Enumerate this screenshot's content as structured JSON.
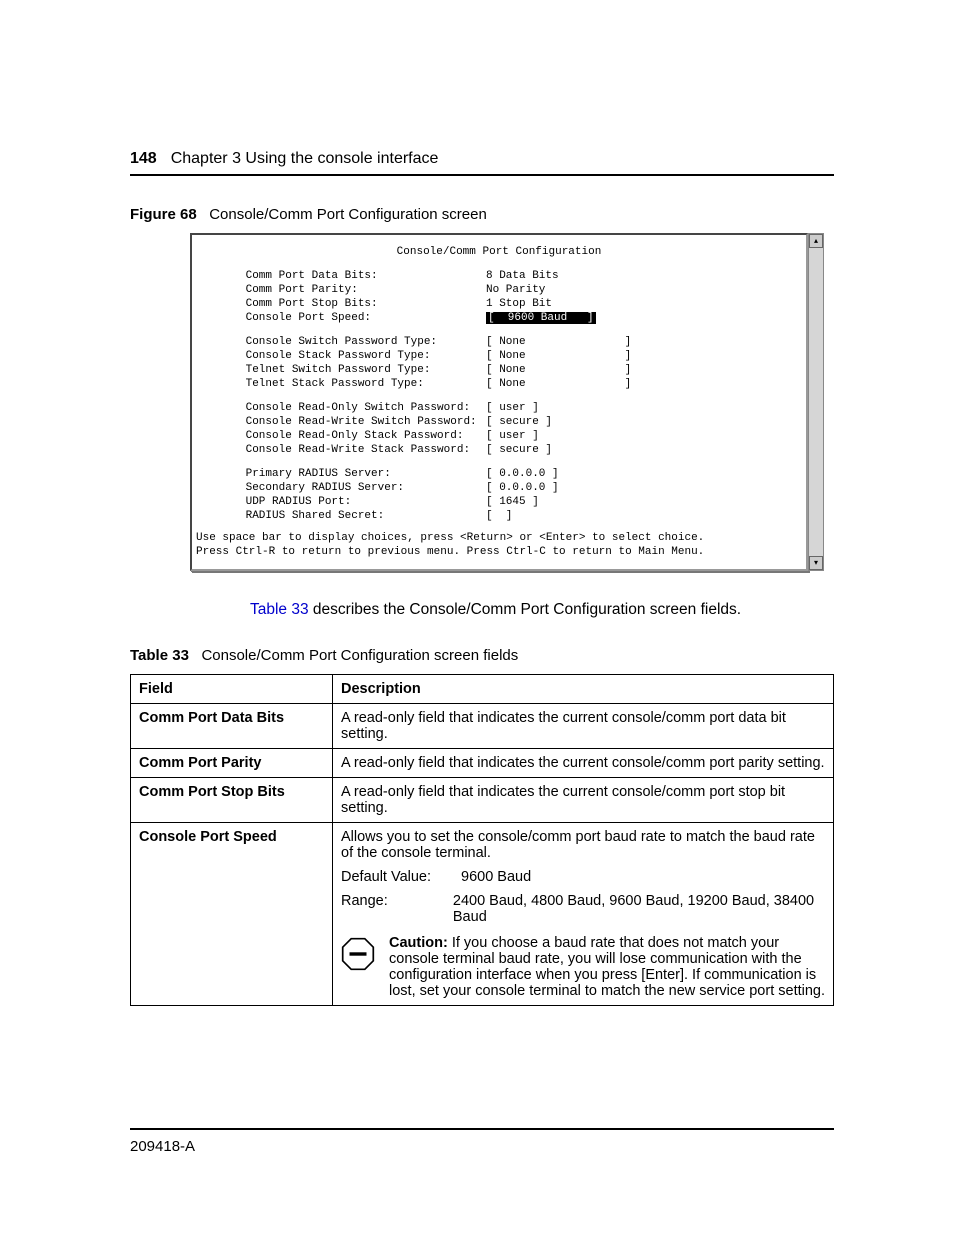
{
  "header": {
    "page_num": "148",
    "chapter": "Chapter 3  Using the console interface"
  },
  "figure": {
    "label": "Figure 68",
    "title": "Console/Comm Port Configuration screen"
  },
  "screenshot": {
    "title": "Console/Comm Port Configuration",
    "rows": [
      {
        "label": "Comm Port Data Bits:",
        "value": "8 Data Bits"
      },
      {
        "label": "Comm Port Parity:",
        "value": "No Parity"
      },
      {
        "label": "Comm Port Stop Bits:",
        "value": "1 Stop Bit"
      },
      {
        "label": "Console Port Speed:",
        "value": "[  9600 Baud   ]",
        "selected": true
      }
    ],
    "rows2": [
      {
        "label": "Console Switch Password Type:",
        "value": "[ None               ]"
      },
      {
        "label": "Console Stack Password Type:",
        "value": "[ None               ]"
      },
      {
        "label": "Telnet Switch Password Type:",
        "value": "[ None               ]"
      },
      {
        "label": "Telnet Stack Password Type:",
        "value": "[ None               ]"
      }
    ],
    "rows3": [
      {
        "label": "Console Read-Only Switch Password:",
        "value": "[ user ]"
      },
      {
        "label": "Console Read-Write Switch Password:",
        "value": "[ secure ]"
      },
      {
        "label": "Console Read-Only Stack Password:",
        "value": "[ user ]"
      },
      {
        "label": "Console Read-Write Stack Password:",
        "value": "[ secure ]"
      }
    ],
    "rows4": [
      {
        "label": "Primary RADIUS Server:",
        "value": "[ 0.0.0.0 ]"
      },
      {
        "label": "Secondary RADIUS Server:",
        "value": "[ 0.0.0.0 ]"
      },
      {
        "label": "UDP RADIUS Port:",
        "value": "[ 1645 ]"
      },
      {
        "label": "RADIUS Shared Secret:",
        "value": "[  ]"
      }
    ],
    "help1": "Use space bar to display choices, press <Return> or <Enter> to select choice.",
    "help2": "Press Ctrl-R to return to previous menu.  Press Ctrl-C to return to Main Menu."
  },
  "body_text": {
    "link": "Table 33",
    "rest": " describes the Console/Comm Port Configuration screen fields."
  },
  "table": {
    "label": "Table 33",
    "title": "Console/Comm Port Configuration screen fields",
    "head_field": "Field",
    "head_desc": "Description",
    "rows": [
      {
        "field": "Comm Port Data Bits",
        "desc": "A read-only field that indicates the current console/comm port data bit setting."
      },
      {
        "field": "Comm Port Parity",
        "desc": "A read-only field that indicates the current console/comm port parity setting."
      },
      {
        "field": "Comm Port Stop Bits",
        "desc": "A read-only field that indicates the current console/comm port stop bit setting."
      }
    ],
    "speed": {
      "field": "Console Port Speed",
      "desc": "Allows you to set the console/comm port baud rate to match the baud rate of the console terminal.",
      "default_label": "Default Value:",
      "default_value": "9600 Baud",
      "range_label": "Range:",
      "range_value": "2400 Baud, 4800 Baud, 9600 Baud, 19200 Baud, 38400 Baud",
      "caution_label": "Caution:",
      "caution_text": " If you choose a baud rate that does not match your console terminal baud rate, you will lose communication with the configuration interface when you press [Enter]. If communication is lost, set your console terminal to match the new service port setting."
    }
  },
  "footer": {
    "doc_id": "209418-A"
  }
}
